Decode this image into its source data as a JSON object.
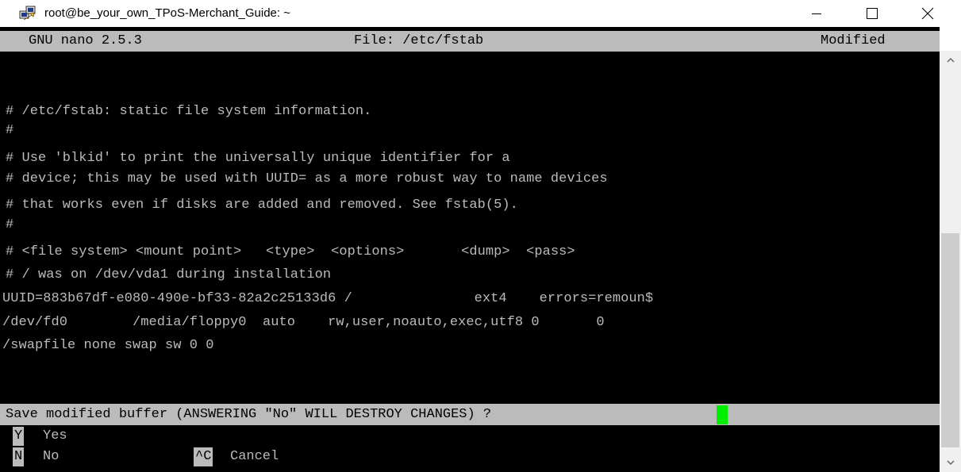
{
  "window": {
    "title": "root@be_your_own_TPoS-Merchant_Guide: ~",
    "icons": {
      "app": "putty-icon",
      "minimize": "minimize-icon",
      "maximize": "maximize-icon",
      "close": "close-icon"
    }
  },
  "nano": {
    "header": {
      "version": "GNU nano 2.5.3",
      "file": "File: /etc/fstab",
      "status": "Modified"
    },
    "lines": [
      "# /etc/fstab: static file system information.",
      "#",
      "# Use 'blkid' to print the universally unique identifier for a",
      "# device; this may be used with UUID= as a more robust way to name devices",
      "# that works even if disks are added and removed. See fstab(5).",
      "#",
      "# <file system> <mount point>   <type>  <options>       <dump>  <pass>",
      "# / was on /dev/vda1 during installation",
      "UUID=883b67df-e080-490e-bf33-82a2c25133d6 /               ext4    errors=remoun$",
      "/dev/fd0        /media/floppy0  auto    rw,user,noauto,exec,utf8 0       0",
      "/swapfile none swap sw 0 0"
    ],
    "prompt": "Save modified buffer (ANSWERING \"No\" WILL DESTROY CHANGES) ?",
    "options": {
      "yes": {
        "key": "Y",
        "label": "Yes"
      },
      "no": {
        "key": "N",
        "label": "No"
      },
      "cancel": {
        "key": "^C",
        "label": "Cancel"
      }
    }
  },
  "colors": {
    "terminal_bg": "#000000",
    "terminal_fg": "#bbbbbb",
    "highlight_bg": "#bbbbbb",
    "cursor": "#00ee00"
  }
}
